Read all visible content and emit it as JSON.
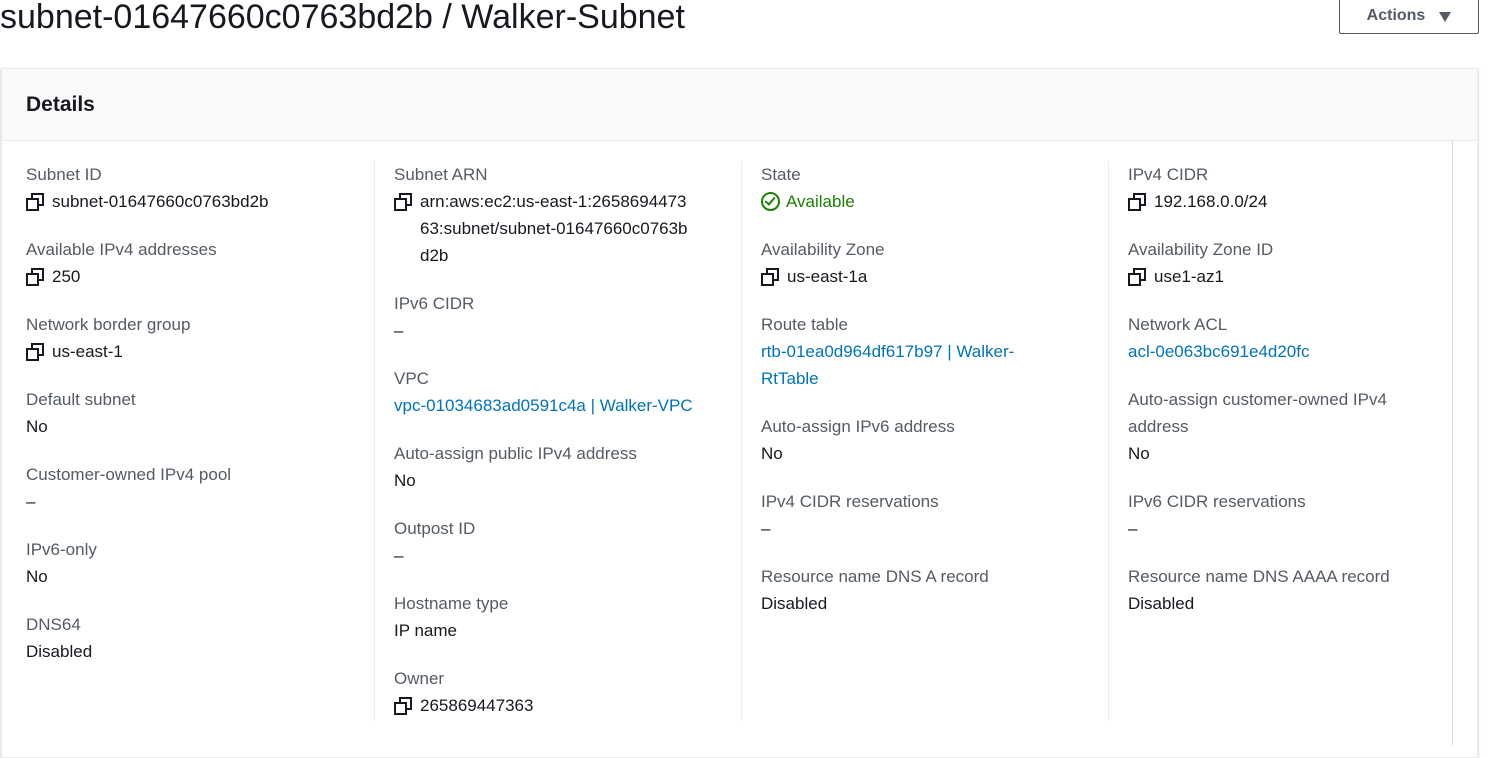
{
  "header": {
    "title": "subnet-01647660c0763bd2b / Walker-Subnet",
    "actions_label": "Actions"
  },
  "details": {
    "title": "Details",
    "col1": {
      "subnet_id_label": "Subnet ID",
      "subnet_id": "subnet-01647660c0763bd2b",
      "available_ipv4_label": "Available IPv4 addresses",
      "available_ipv4": "250",
      "network_border_group_label": "Network border group",
      "network_border_group": "us-east-1",
      "default_subnet_label": "Default subnet",
      "default_subnet": "No",
      "customer_owned_pool_label": "Customer-owned IPv4 pool",
      "customer_owned_pool": "–",
      "ipv6_only_label": "IPv6-only",
      "ipv6_only": "No",
      "dns64_label": "DNS64",
      "dns64": "Disabled"
    },
    "col2": {
      "subnet_arn_label": "Subnet ARN",
      "subnet_arn": "arn:aws:ec2:us-east-1:265869447363:subnet/subnet-01647660c0763bd2b",
      "ipv6_cidr_label": "IPv6 CIDR",
      "ipv6_cidr": "–",
      "vpc_label": "VPC",
      "vpc": "vpc-01034683ad0591c4a | Walker-VPC",
      "auto_assign_public_label": "Auto-assign public IPv4 address",
      "auto_assign_public": "No",
      "outpost_id_label": "Outpost ID",
      "outpost_id": "–",
      "hostname_type_label": "Hostname type",
      "hostname_type": "IP name",
      "owner_label": "Owner",
      "owner": "265869447363"
    },
    "col3": {
      "state_label": "State",
      "state": "Available",
      "az_label": "Availability Zone",
      "az": "us-east-1a",
      "route_table_label": "Route table",
      "route_table": "rtb-01ea0d964df617b97 | Walker-RtTable",
      "auto_assign_ipv6_label": "Auto-assign IPv6 address",
      "auto_assign_ipv6": "No",
      "ipv4_cidr_reservations_label": "IPv4 CIDR reservations",
      "ipv4_cidr_reservations": "–",
      "dns_a_label": "Resource name DNS A record",
      "dns_a": "Disabled"
    },
    "col4": {
      "ipv4_cidr_label": "IPv4 CIDR",
      "ipv4_cidr": "192.168.0.0/24",
      "az_id_label": "Availability Zone ID",
      "az_id": "use1-az1",
      "network_acl_label": "Network ACL",
      "network_acl": "acl-0e063bc691e4d20fc",
      "auto_assign_customer_label": "Auto-assign customer-owned IPv4 address",
      "auto_assign_customer": "No",
      "ipv6_cidr_reservations_label": "IPv6 CIDR reservations",
      "ipv6_cidr_reservations": "–",
      "dns_aaaa_label": "Resource name DNS AAAA record",
      "dns_aaaa": "Disabled"
    }
  },
  "colors": {
    "link": "#0073bb",
    "success": "#1d8102",
    "label": "#545b64",
    "text": "#16191f"
  }
}
